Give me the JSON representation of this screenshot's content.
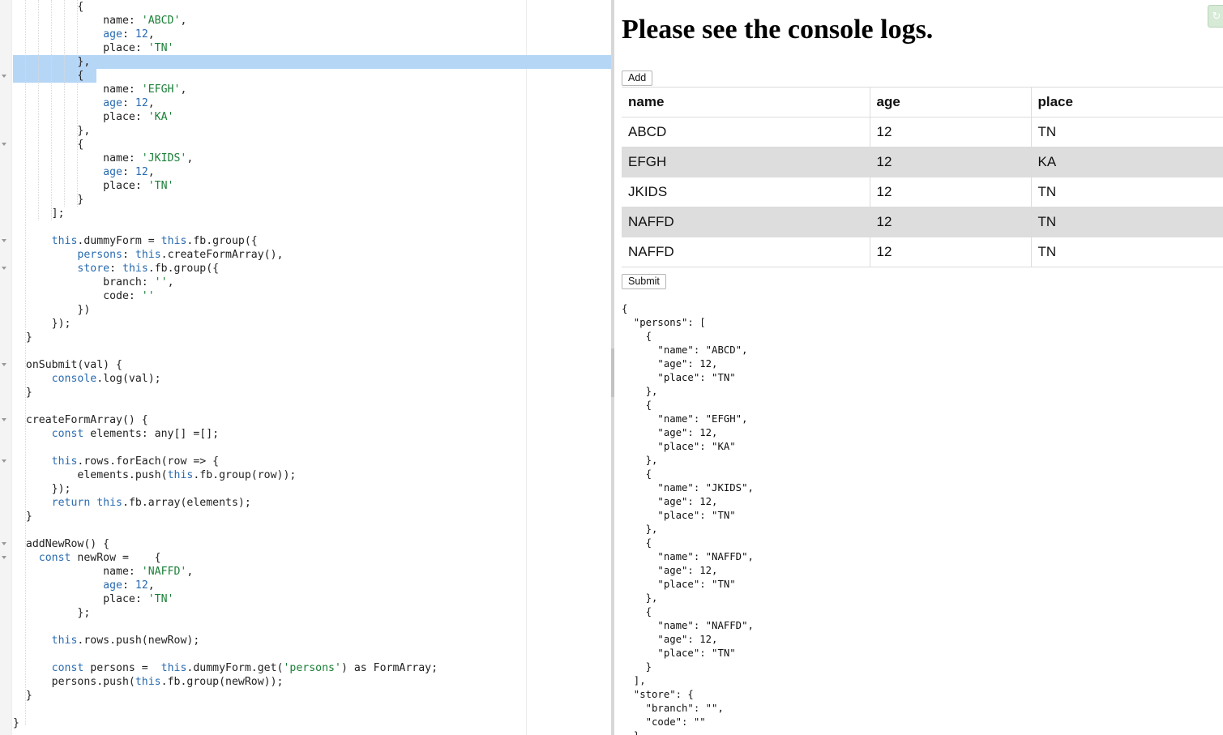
{
  "editor": {
    "lines": [
      "          {",
      "              name: 'ABCD',",
      "              age: 12,",
      "              place: 'TN'",
      "          },",
      "          {",
      "              name: 'EFGH',",
      "              age: 12,",
      "              place: 'KA'",
      "          },",
      "          {",
      "              name: 'JKIDS',",
      "              age: 12,",
      "              place: 'TN'",
      "          }",
      "      ];",
      "",
      "      this.dummyForm = this.fb.group({",
      "          persons: this.createFormArray(),",
      "          store: this.fb.group({",
      "              branch: '',",
      "              code: ''",
      "          })",
      "      });",
      "  }",
      "",
      "  onSubmit(val) {",
      "      console.log(val);",
      "  }",
      "",
      "  createFormArray() {",
      "      const elements: any[] =[];",
      "",
      "      this.rows.forEach(row => {",
      "          elements.push(this.fb.group(row));",
      "      });",
      "      return this.fb.array(elements);",
      "  }",
      "",
      "  addNewRow() {",
      "    const newRow =    {",
      "              name: 'NAFFD',",
      "              age: 12,",
      "              place: 'TN'",
      "          };",
      "",
      "      this.rows.push(newRow);",
      "",
      "      const persons =  this.dummyForm.get('persons') as FormArray;",
      "      persons.push(this.fb.group(newRow));",
      "  }",
      "",
      "}"
    ]
  },
  "preview": {
    "heading": "Please see the console logs.",
    "add_label": "Add",
    "submit_label": "Submit",
    "refresh_icon": "↻",
    "table": {
      "headers": [
        "name",
        "age",
        "place"
      ],
      "rows": [
        [
          "ABCD",
          "12",
          "TN"
        ],
        [
          "EFGH",
          "12",
          "KA"
        ],
        [
          "JKIDS",
          "12",
          "TN"
        ],
        [
          "NAFFD",
          "12",
          "TN"
        ],
        [
          "NAFFD",
          "12",
          "TN"
        ]
      ]
    },
    "json_output": "{\n  \"persons\": [\n    {\n      \"name\": \"ABCD\",\n      \"age\": 12,\n      \"place\": \"TN\"\n    },\n    {\n      \"name\": \"EFGH\",\n      \"age\": 12,\n      \"place\": \"KA\"\n    },\n    {\n      \"name\": \"JKIDS\",\n      \"age\": 12,\n      \"place\": \"TN\"\n    },\n    {\n      \"name\": \"NAFFD\",\n      \"age\": 12,\n      \"place\": \"TN\"\n    },\n    {\n      \"name\": \"NAFFD\",\n      \"age\": 12,\n      \"place\": \"TN\"\n    }\n  ],\n  \"store\": {\n    \"branch\": \"\",\n    \"code\": \"\"\n  }\n}"
  },
  "colors": {
    "selection": "#b6d6f6",
    "keyword": "#2a6bb0",
    "string": "#1a7f37",
    "shaded_row": "#dddddd"
  }
}
